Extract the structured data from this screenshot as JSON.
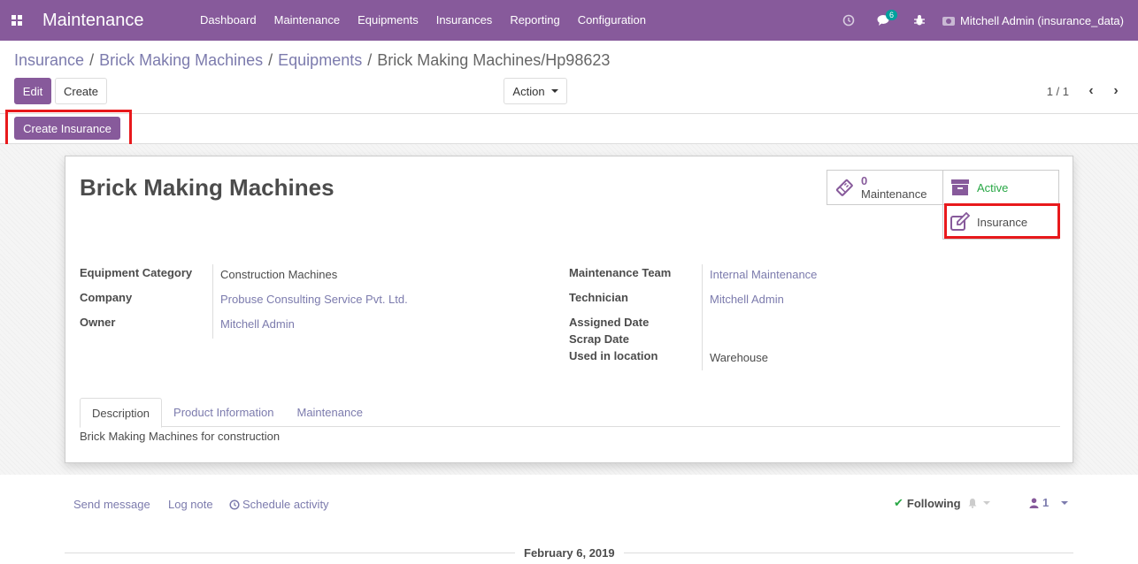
{
  "navbar": {
    "app_title": "Maintenance",
    "menu": [
      "Dashboard",
      "Maintenance",
      "Equipments",
      "Insurances",
      "Reporting",
      "Configuration"
    ],
    "messages_badge": "6",
    "user": "Mitchell Admin (insurance_data)"
  },
  "breadcrumb": {
    "items": [
      "Insurance",
      "Brick Making Machines",
      "Equipments"
    ],
    "current": "Brick Making Machines/Hp98623",
    "sep": "/"
  },
  "toolbar": {
    "edit_label": "Edit",
    "create_label": "Create",
    "action_label": "Action",
    "pager": "1 / 1"
  },
  "statusbar": {
    "create_insurance_label": "Create Insurance"
  },
  "record": {
    "title": "Brick Making Machines",
    "smart_buttons": {
      "maintenance_count": "0",
      "maintenance_label": "Maintenance",
      "active_label": "Active",
      "insurance_label": "Insurance"
    },
    "left_fields": {
      "equipment_category_label": "Equipment Category",
      "equipment_category": "Construction Machines",
      "company_label": "Company",
      "company": "Probuse Consulting Service Pvt. Ltd.",
      "owner_label": "Owner",
      "owner": "Mitchell Admin"
    },
    "right_fields": {
      "maintenance_team_label": "Maintenance Team",
      "maintenance_team": "Internal Maintenance",
      "technician_label": "Technician",
      "technician": "Mitchell Admin",
      "assigned_date_label": "Assigned Date",
      "scrap_date_label": "Scrap Date",
      "used_in_location_label": "Used in location",
      "used_in_location": "Warehouse"
    },
    "tabs": [
      "Description",
      "Product Information",
      "Maintenance"
    ],
    "description": "Brick Making Machines for construction"
  },
  "chatter": {
    "send_message": "Send message",
    "log_note": "Log note",
    "schedule_activity": "Schedule activity",
    "following": "Following",
    "followers_count": "1",
    "date": "February 6, 2019"
  },
  "colors": {
    "brand": "#875a9b",
    "link": "#7c7bad",
    "active": "#28a745",
    "highlight": "#e8191c"
  }
}
